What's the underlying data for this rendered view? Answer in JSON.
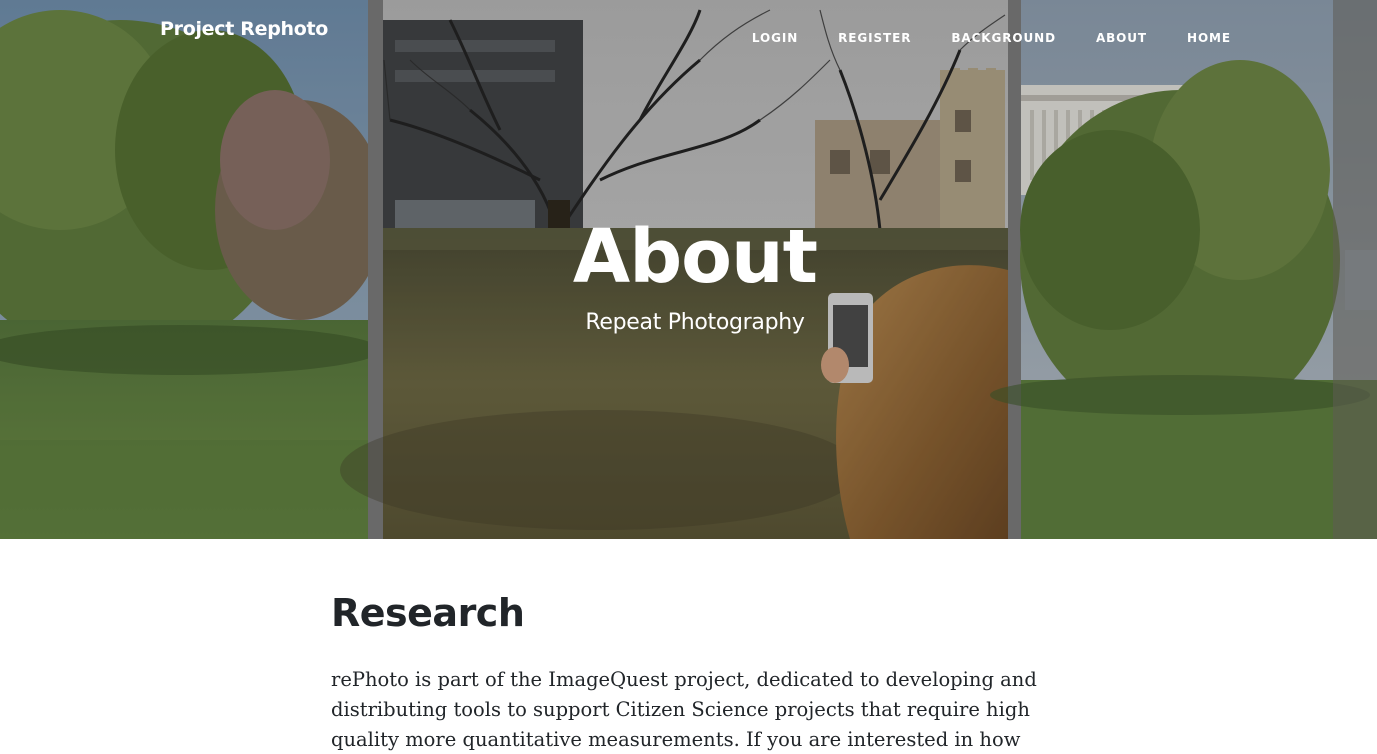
{
  "navbar": {
    "brand": "Project Rephoto",
    "links": [
      "LOGIN",
      "REGISTER",
      "BACKGROUND",
      "ABOUT",
      "HOME"
    ]
  },
  "hero": {
    "title": "About",
    "subtitle": "Repeat Photography"
  },
  "main": {
    "section_title": "Research",
    "body": "rePhoto is part of the ImageQuest project, dedicated to developing and distributing tools to support Citizen Science projects that require high quality more quantitative measurements. If you are interested in how rePhoto might"
  },
  "colors": {
    "hero_text": "#ffffff",
    "body_text": "#212529",
    "page_background": "#ffffff"
  }
}
